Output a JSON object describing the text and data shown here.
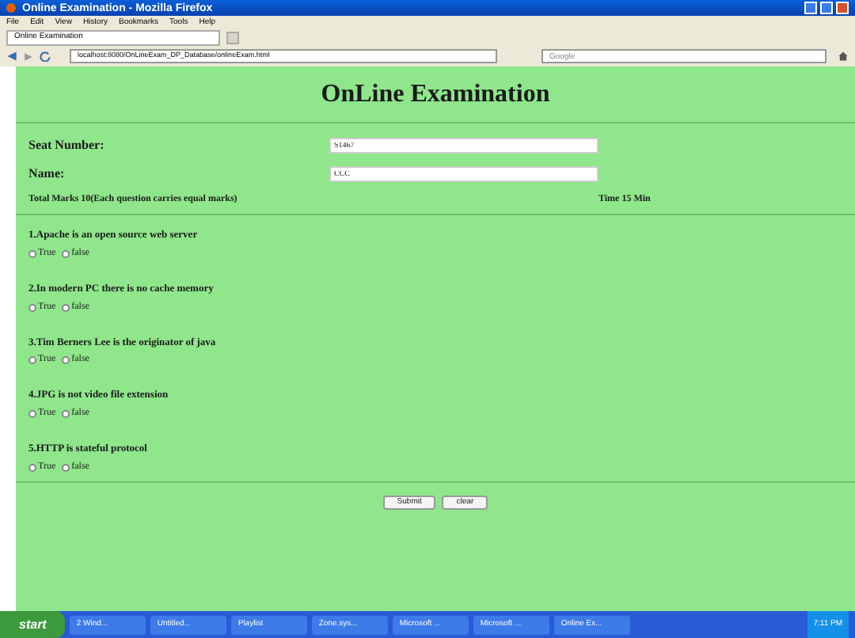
{
  "window": {
    "title": "Online Examination - Mozilla Firefox"
  },
  "menu": [
    "File",
    "Edit",
    "View",
    "History",
    "Bookmarks",
    "Tools",
    "Help"
  ],
  "tabs": [
    {
      "label": "Online Examination",
      "selected": true
    }
  ],
  "address_bar": {
    "value": "localhost:8080/OnLineExam_DP_Database/onlineExam.html"
  },
  "search": {
    "placeholder": "Google"
  },
  "page": {
    "heading": "OnLine Examination",
    "fields": [
      {
        "label": "Seat Number:",
        "value": "S1467"
      },
      {
        "label": "Name:",
        "value": "CCC"
      }
    ],
    "info": "Total Marks 10(Each question carries equal marks)",
    "time": "Time 15 Min",
    "questions": [
      {
        "text": "1.Apache is an open source web server",
        "options": [
          {
            "label": "True",
            "selected": false
          },
          {
            "label": "false",
            "selected": false
          }
        ]
      },
      {
        "text": "2.In modern PC there is no cache memory",
        "options": [
          {
            "label": "True",
            "selected": false
          },
          {
            "label": "false",
            "selected": false
          }
        ]
      },
      {
        "text": "3.Tim Berners Lee is the originator of java",
        "options": [
          {
            "label": "True",
            "selected": false
          },
          {
            "label": "false",
            "selected": false
          }
        ]
      },
      {
        "text": "4.JPG is not video file extension",
        "options": [
          {
            "label": "True",
            "selected": false
          },
          {
            "label": "false",
            "selected": false
          }
        ]
      },
      {
        "text": "5.HTTP is stateful protocol",
        "options": [
          {
            "label": "True",
            "selected": false
          },
          {
            "label": "false",
            "selected": false
          }
        ]
      }
    ],
    "buttons": [
      "Submit",
      "clear"
    ]
  },
  "taskbar": {
    "start": "start",
    "items": [
      "2 Wind...",
      "Untitled...",
      "Playlist",
      "Zone.sys...",
      "Microsoft ...",
      "Microsoft ...",
      "Online Ex..."
    ],
    "clock": "7:11 PM"
  }
}
